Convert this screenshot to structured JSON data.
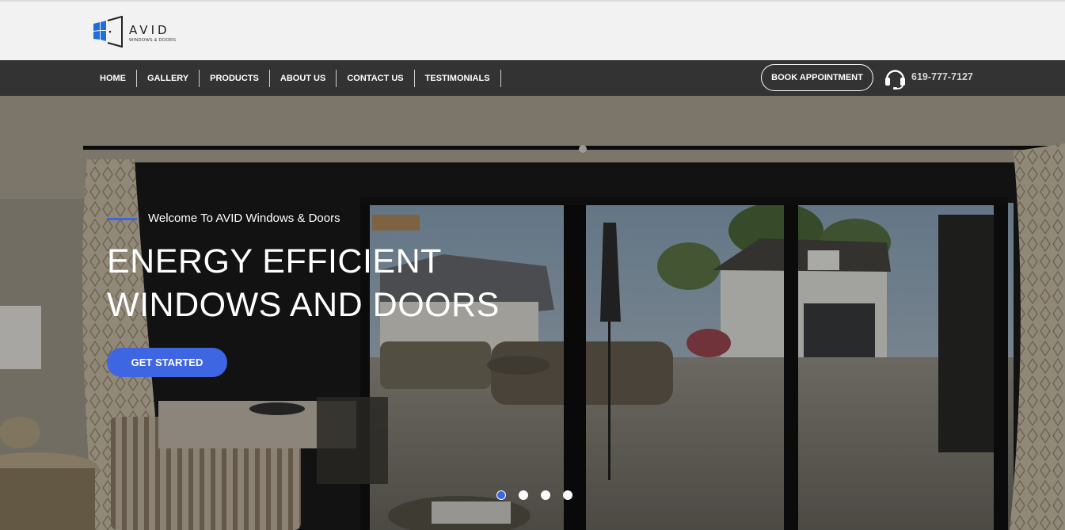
{
  "brand": {
    "name": "AVID",
    "tagline": "WINDOWS & DOORS",
    "accent": "#3e66e2",
    "logo_blue": "#1e6fd8"
  },
  "nav": {
    "items": [
      {
        "label": "HOME"
      },
      {
        "label": "GALLERY"
      },
      {
        "label": "PRODUCTS"
      },
      {
        "label": "ABOUT US"
      },
      {
        "label": "CONTACT US"
      },
      {
        "label": "TESTIMONIALS"
      }
    ],
    "book_button": "BOOK APPOINTMENT",
    "phone_icon": "headset-icon",
    "phone": "619-777-7127"
  },
  "hero": {
    "welcome": "Welcome To AVID Windows & Doors",
    "headline_line1": "ENERGY EFFICIENT",
    "headline_line2": "WINDOWS AND DOORS",
    "cta": "GET STARTED",
    "slides_total": 4,
    "active_slide": 1
  }
}
